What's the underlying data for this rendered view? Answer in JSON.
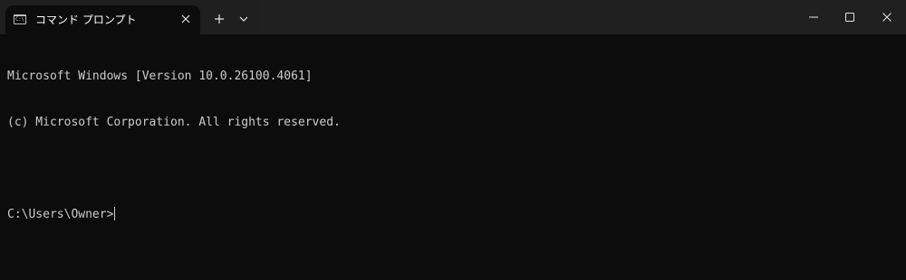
{
  "tab": {
    "title": "コマンド プロンプト",
    "icon": "command-prompt-icon",
    "icon_text": "C:\\_"
  },
  "toolbar": {
    "new_tab_icon": "plus-icon",
    "dropdown_icon": "chevron-down-icon"
  },
  "window_controls": {
    "minimize_icon": "minimize-icon",
    "maximize_icon": "maximize-icon",
    "close_icon": "close-icon"
  },
  "terminal": {
    "lines": [
      "Microsoft Windows [Version 10.0.26100.4061]",
      "(c) Microsoft Corporation. All rights reserved.",
      "",
      "C:\\Users\\Owner>"
    ]
  },
  "colors": {
    "background": "#0c0c0c",
    "titlebar": "#1f1f1f",
    "text": "#cccccc"
  }
}
